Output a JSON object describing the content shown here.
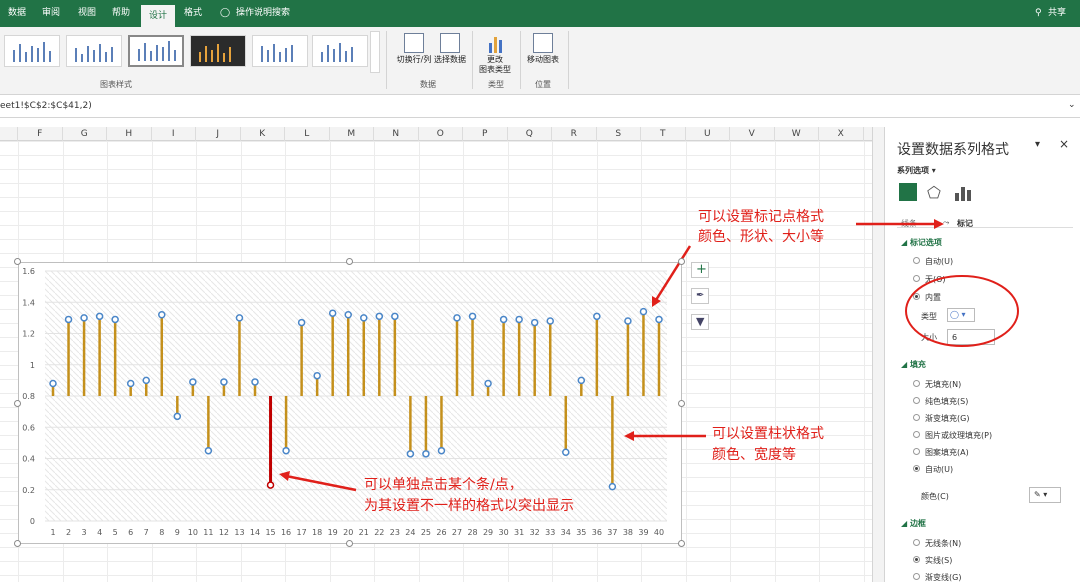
{
  "tabs": [
    "数据",
    "审阅",
    "视图",
    "帮助",
    "设计",
    "格式",
    "操作说明搜索"
  ],
  "share": "共享",
  "ribbon": {
    "styles_label": "图表样式",
    "switch": "切换行/列",
    "select": "选择数据",
    "data_label": "数据",
    "change": "更改",
    "change2": "图表类型",
    "type_label": "类型",
    "move": "移动图表",
    "pos_label": "位置"
  },
  "formula": "eet1!$C$2:$C$41,2)",
  "columns": [
    "F",
    "G",
    "H",
    "I",
    "J",
    "K",
    "L",
    "M",
    "N",
    "O",
    "P",
    "Q",
    "R",
    "S",
    "T",
    "U",
    "V",
    "W",
    "X",
    "Y"
  ],
  "chart_data": {
    "type": "line",
    "x": [
      1,
      2,
      3,
      4,
      5,
      6,
      7,
      8,
      9,
      10,
      11,
      12,
      13,
      14,
      15,
      16,
      17,
      18,
      19,
      20,
      21,
      22,
      23,
      24,
      25,
      26,
      27,
      28,
      29,
      30,
      31,
      32,
      33,
      34,
      35,
      36,
      37,
      38,
      39,
      40
    ],
    "values": [
      0.88,
      1.29,
      1.3,
      1.31,
      1.29,
      0.88,
      0.9,
      1.32,
      0.67,
      0.89,
      0.45,
      0.89,
      1.3,
      0.89,
      0.23,
      0.45,
      1.27,
      0.93,
      1.33,
      1.32,
      1.3,
      1.31,
      1.31,
      0.43,
      0.43,
      0.45,
      1.3,
      1.31,
      0.88,
      1.29,
      1.29,
      1.27,
      1.28,
      0.44,
      0.9,
      1.31,
      0.22,
      1.28,
      1.34,
      1.29
    ],
    "ylim": [
      0,
      1.6
    ],
    "yticks": [
      "0",
      "0.2",
      "0.4",
      "0.6",
      "0.8",
      "1",
      "1.2",
      "1.4",
      "1.6"
    ],
    "baseline": 0.8,
    "stem_color": "#c4901c",
    "highlight_color": "#c00000",
    "highlight_index": 14
  },
  "pane": {
    "title": "设置数据系列格式",
    "series_options": "系列选项",
    "tab_line": "线条",
    "tab_marker": "标记",
    "marker_opts": "标记选项",
    "auto": "自动(U)",
    "none": "无(O)",
    "builtin": "内置",
    "type": "类型",
    "size": "大小",
    "size_val": "6",
    "fill": "填充",
    "nofill": "无填充(N)",
    "solid": "纯色填充(S)",
    "grad": "渐变填充(G)",
    "pic": "图片或纹理填充(P)",
    "pattern": "图案填充(A)",
    "auto2": "自动(U)",
    "color": "颜色(C)",
    "border": "边框",
    "noline": "无线条(N)",
    "solidline": "实线(S)",
    "gradline": "渐变线(G)"
  },
  "annotations": {
    "a1": "可以设置标记点格式",
    "a2": "颜色、形状、大小等",
    "a3": "可以设置柱状格式",
    "a4": "颜色、宽度等",
    "a5": "可以单独点击某个条/点，",
    "a6": "为其设置不一样的格式以突出显示"
  }
}
